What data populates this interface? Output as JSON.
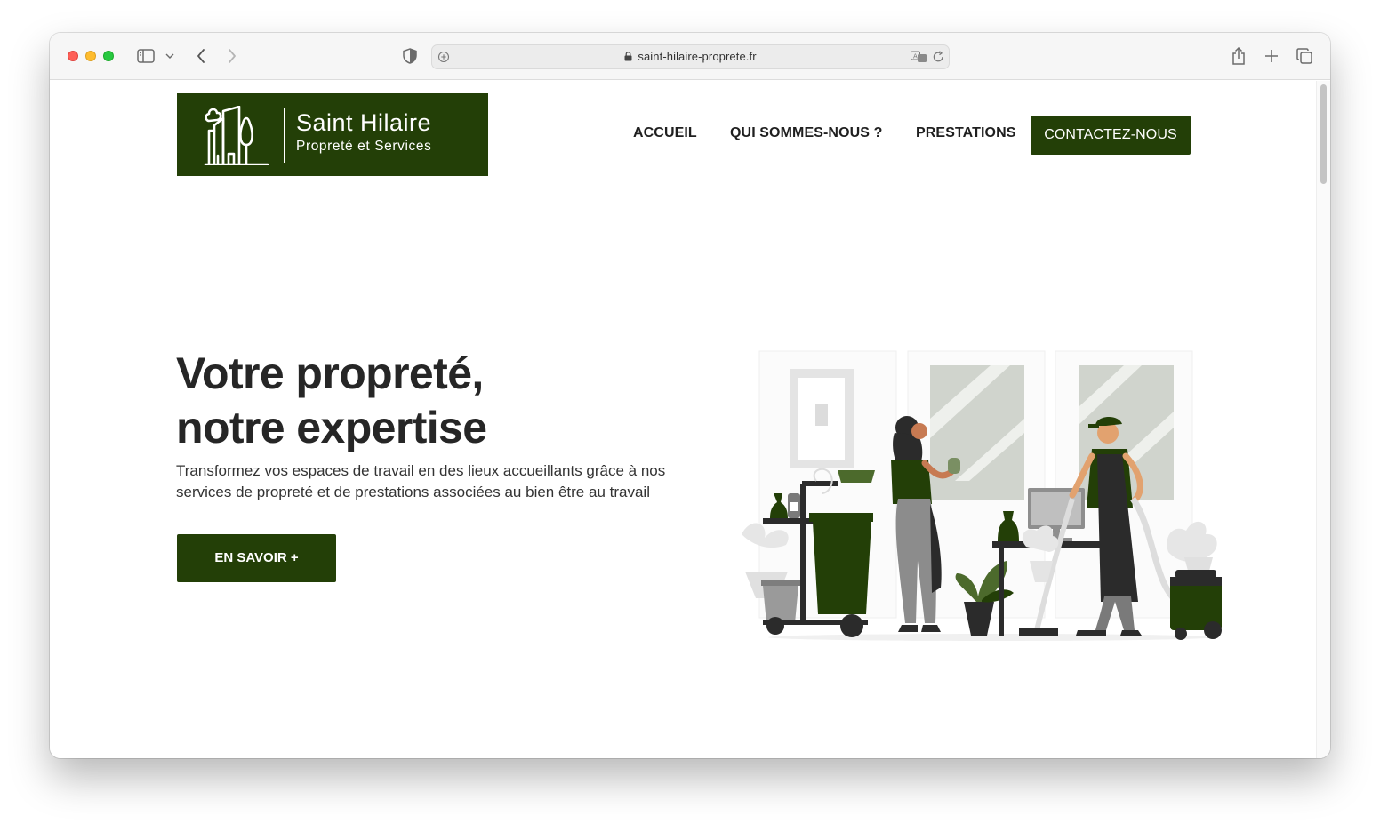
{
  "browser": {
    "url": "saint-hilaire-proprete.fr"
  },
  "site": {
    "logo": {
      "title": "Saint Hilaire",
      "subtitle": "Propreté et Services"
    },
    "nav": {
      "items": [
        {
          "label": "ACCUEIL"
        },
        {
          "label": "QUI SOMMES-NOUS ?"
        },
        {
          "label": "PRESTATIONS"
        }
      ],
      "cta_label": "CONTACTEZ-NOUS"
    },
    "hero": {
      "title_line1": "Votre propreté,",
      "title_line2": "notre expertise",
      "text": "Transformez vos espaces de travail en des lieux accueillants grâce à nos services de propreté et de prestations associées au bien être au travail",
      "button_label": "EN SAVOIR +"
    },
    "colors": {
      "brand": "#233f07",
      "text": "#262626"
    }
  }
}
